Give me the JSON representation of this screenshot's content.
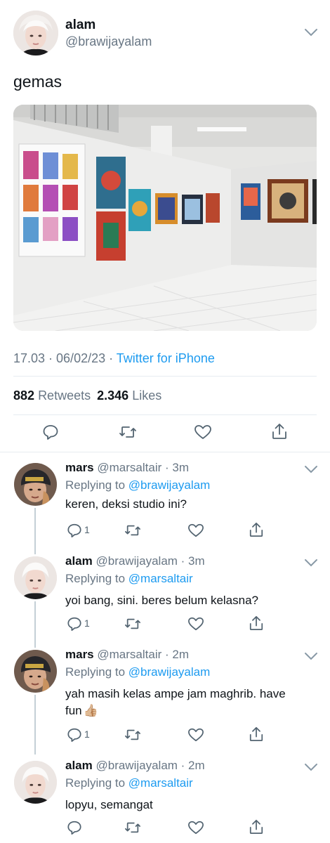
{
  "tweet": {
    "author_name": "alam",
    "author_handle": "@brawijayalam",
    "text": "gemas",
    "time": "17.03 · 06/02/23 ·",
    "source": "Twitter for iPhone",
    "retweets_count": "882",
    "retweets_label": "Retweets",
    "likes_count": "2.346",
    "likes_label": "Likes"
  },
  "replies": [
    {
      "name": "mars",
      "handle_time": "@marsaltair · 3m",
      "replying_prefix": "Replying to",
      "replying_to": "@brawijayalam",
      "text": "keren, deksi studio ini?",
      "reply_count": "1"
    },
    {
      "name": "alam",
      "handle_time": "@brawijayalam · 3m",
      "replying_prefix": "Replying to",
      "replying_to": "@marsaltair",
      "text": "yoi bang, sini. beres belum kelasna?",
      "reply_count": "1"
    },
    {
      "name": "mars",
      "handle_time": "@marsaltair · 2m",
      "replying_prefix": "Replying to",
      "replying_to": "@brawijayalam",
      "text_line1": "yah masih kelas ampe jam maghrib. have",
      "text_line2": "fun",
      "emoji": "👍🏼",
      "reply_count": "1"
    },
    {
      "name": "alam",
      "handle_time": "@brawijayalam · 2m",
      "replying_prefix": "Replying to",
      "replying_to": "@marsaltair",
      "text": "lopyu, semangat",
      "reply_count": ""
    }
  ],
  "colors": {
    "accent": "#1d9bf0",
    "muted": "#687684",
    "divider": "#e6ecf0"
  },
  "icons": [
    "reply-icon",
    "retweet-icon",
    "like-icon",
    "share-icon",
    "chevron-down-icon"
  ]
}
